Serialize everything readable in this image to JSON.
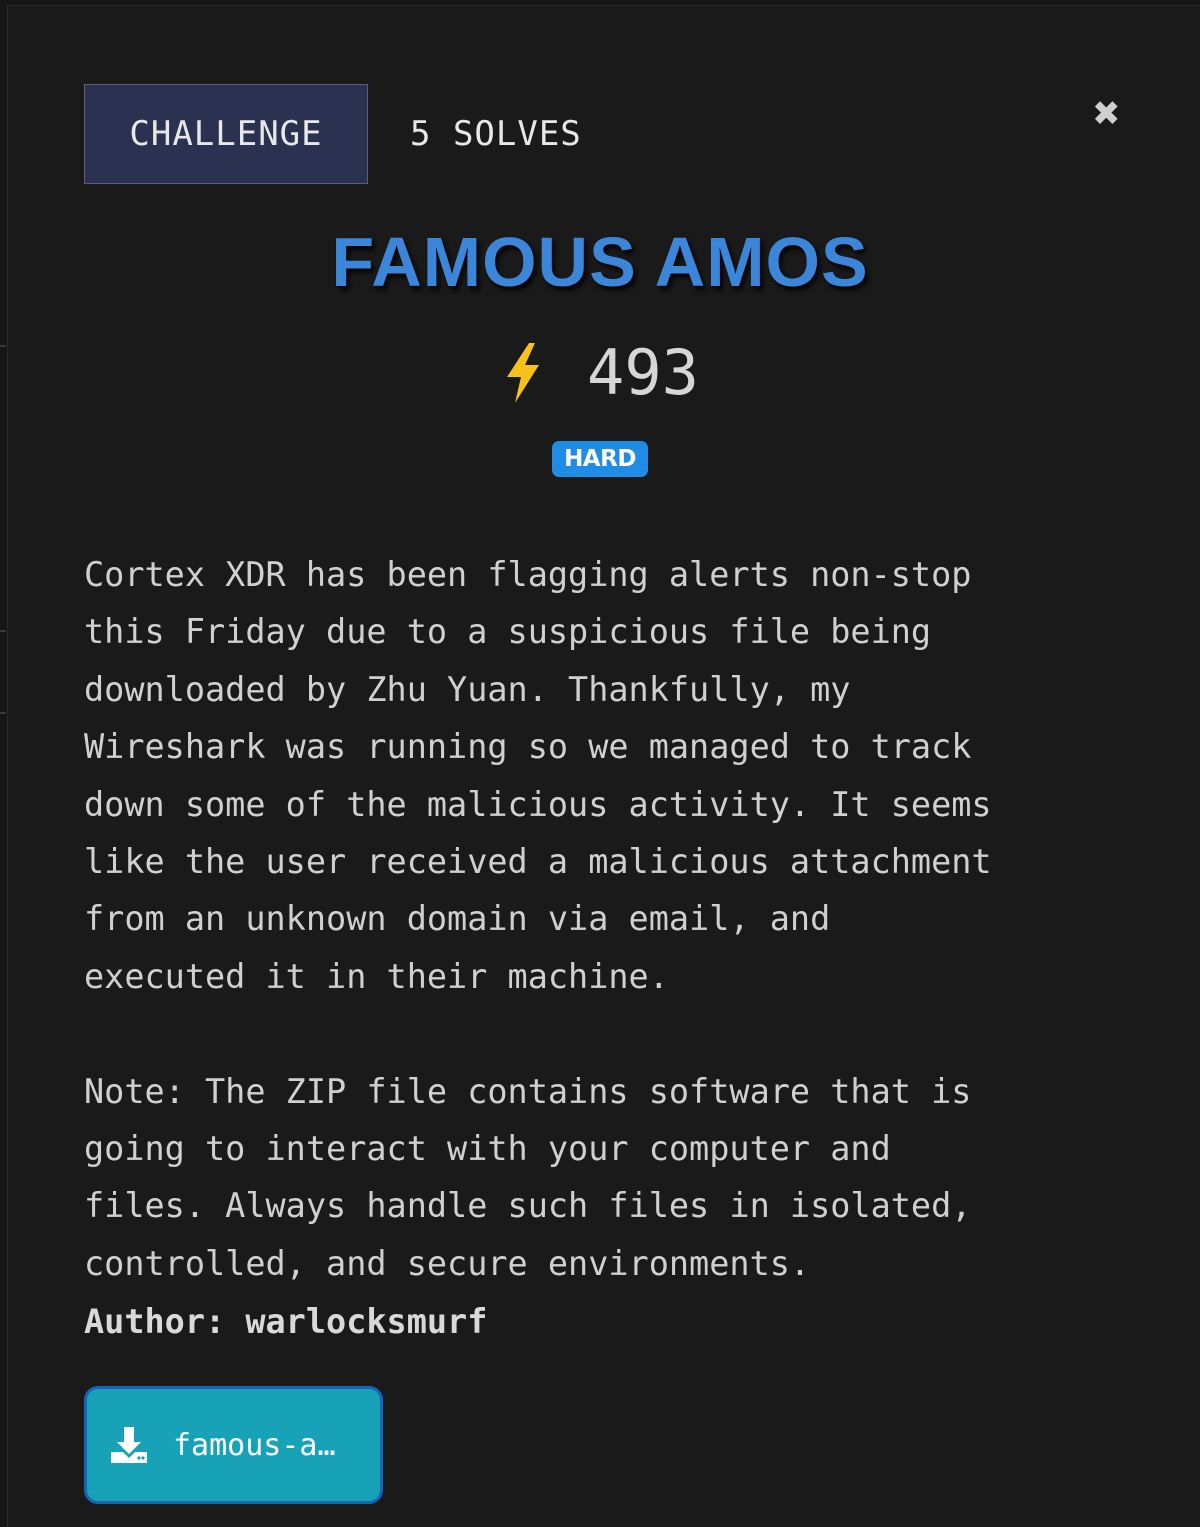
{
  "tabs": {
    "challenge_label": "CHALLENGE",
    "solves_label": "5 SOLVES"
  },
  "close": {
    "icon": "close-icon",
    "glyph": "✖"
  },
  "challenge": {
    "title": "FAMOUS AMOS",
    "points_icon": "lightning-bolt-icon",
    "points": "493",
    "difficulty": "HARD",
    "description": "Cortex XDR has been flagging alerts non-stop\nthis Friday due to a suspicious file being\ndownloaded by Zhu Yuan. Thankfully, my\nWireshark was running so we managed to track\ndown some of the malicious activity. It seems\nlike the user received a malicious attachment\nfrom an unknown domain via email, and\nexecuted it in their machine.\n\nNote: The ZIP file contains software that is\ngoing to interact with your computer and\nfiles. Always handle such files in isolated,\ncontrolled, and secure environments.",
    "author_line": "Author: warlocksmurf"
  },
  "download": {
    "icon": "download-icon",
    "label": "famous-a…"
  },
  "colors": {
    "background": "#1a1a1a",
    "tab_active_bg": "#2b3150",
    "title": "#3c86d9",
    "bolt": "#f6c21a",
    "badge": "#1f8ce6",
    "download_bg": "#17a2b8",
    "download_border": "#1765b8"
  }
}
